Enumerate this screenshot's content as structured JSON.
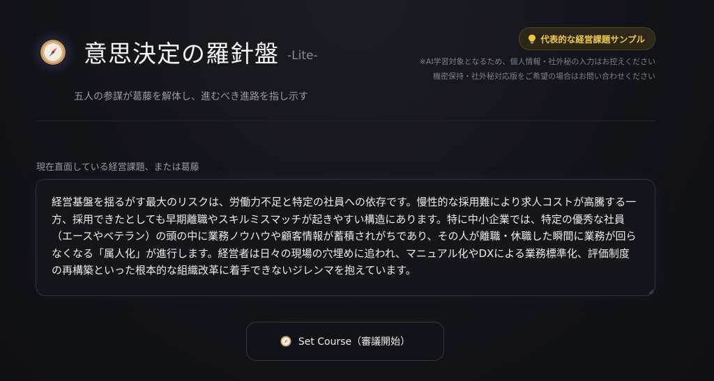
{
  "header": {
    "title": "意思決定の羅針盤",
    "edition": "-Lite-",
    "subtitle": "五人の参謀が葛藤を解体し、進むべき進路を指し示す",
    "logo_icon": "compass-icon"
  },
  "sample_button": {
    "label": "代表的な経営課題サンプル",
    "icon": "lightbulb-icon"
  },
  "notice": {
    "line1": "※AI学習対象となるため、個人情報・社外秘の入力はお控えください",
    "line2": "機密保持・社外秘対応版をご希望の場合はお問い合わせください"
  },
  "input": {
    "label": "現在直面している経営課題、または葛藤",
    "value": "経営基盤を揺るがす最大のリスクは、労働力不足と特定の社員への依存です。慢性的な採用難により求人コストが高騰する一方、採用できたとしても早期離職やスキルミスマッチが起きやすい構造にあります。特に中小企業では、特定の優秀な社員（エースやベテラン）の頭の中に業務ノウハウや顧客情報が蓄積されがちであり、その人が離職・休職した瞬間に業務が回らなくなる「属人化」が進行します。経営者は日々の現場の穴埋めに追われ、マニュアル化やDXによる業務標準化、評価制度の再構築といった根本的な組織改革に着手できないジレンマを抱えています。"
  },
  "action": {
    "label": "Set Course（審議開始）",
    "icon": "compass-icon"
  },
  "colors": {
    "background": "#131419",
    "accent_gold": "#f0c84a",
    "text_primary": "#ececf0",
    "text_muted": "#9a9aa4"
  }
}
